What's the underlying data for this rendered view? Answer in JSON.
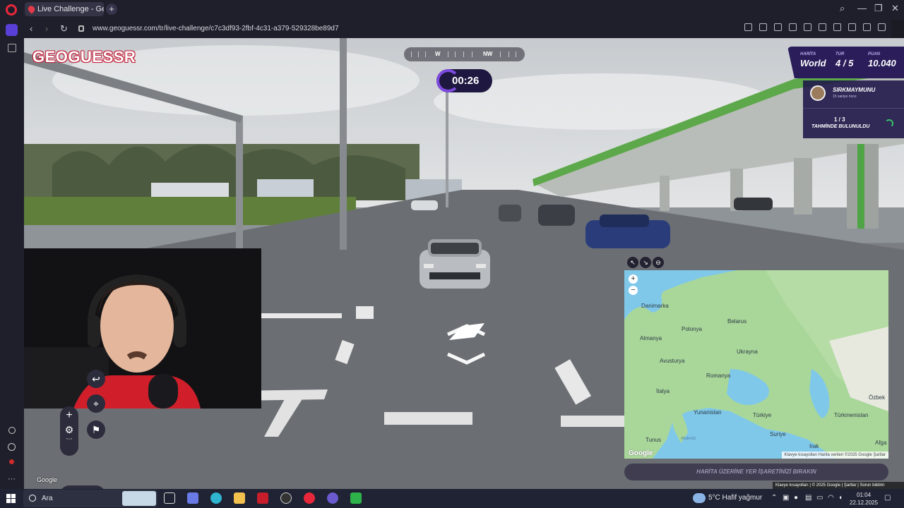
{
  "browser": {
    "tab_title": "Live Challenge - GeoGues",
    "url": "www.geoguessr.com/tr/live-challenge/c7c3df93-2fbf-4c31-a379-529328be89d7"
  },
  "game": {
    "logo": "GEOGUESSR",
    "compass": {
      "w": "W",
      "nw": "NW"
    },
    "timer": "00:26",
    "hud": {
      "map_label": "HARİTA",
      "map_value": "World",
      "round_label": "TUR",
      "round_value": "4 / 5",
      "score_label": "PUAN",
      "score_value": "10.040"
    },
    "player": {
      "name": "SIRKMAYMUNU",
      "subtitle": "15 saniye önce",
      "count": "1 / 3",
      "status": "TAHMİNDE BULUNULDU"
    },
    "map": {
      "labels": [
        {
          "text": "Danimarka"
        },
        {
          "text": "Belarus"
        },
        {
          "text": "Polonya"
        },
        {
          "text": "Almanya"
        },
        {
          "text": "Ukrayna"
        },
        {
          "text": "Avusturya"
        },
        {
          "text": "Romanya"
        },
        {
          "text": "İtalya"
        },
        {
          "text": "Yunanistan"
        },
        {
          "text": "Türkiye"
        },
        {
          "text": "Türkmenistan"
        },
        {
          "text": "Özbek"
        },
        {
          "text": "Suriye"
        },
        {
          "text": "Irak"
        },
        {
          "text": "Tunus"
        },
        {
          "text": "Akdeniz"
        },
        {
          "text": "Afga"
        }
      ],
      "google": "Google",
      "footer": "Klavye kısayolları   Harita verileri ©2025 Google   Şartlar"
    },
    "guess_button": "HARİTA ÜZERİNE YER İŞARETİNİZİ BIRAKIN",
    "google_sv": "Google",
    "sv_footer": "Klavye kısayolları | © 2025 Google | Şartlar | Sorun bildirin"
  },
  "taskbar": {
    "search": "Ara",
    "weather": "5°C  Hafif yağmur",
    "time": "01:04",
    "date": "22.12.2025"
  }
}
